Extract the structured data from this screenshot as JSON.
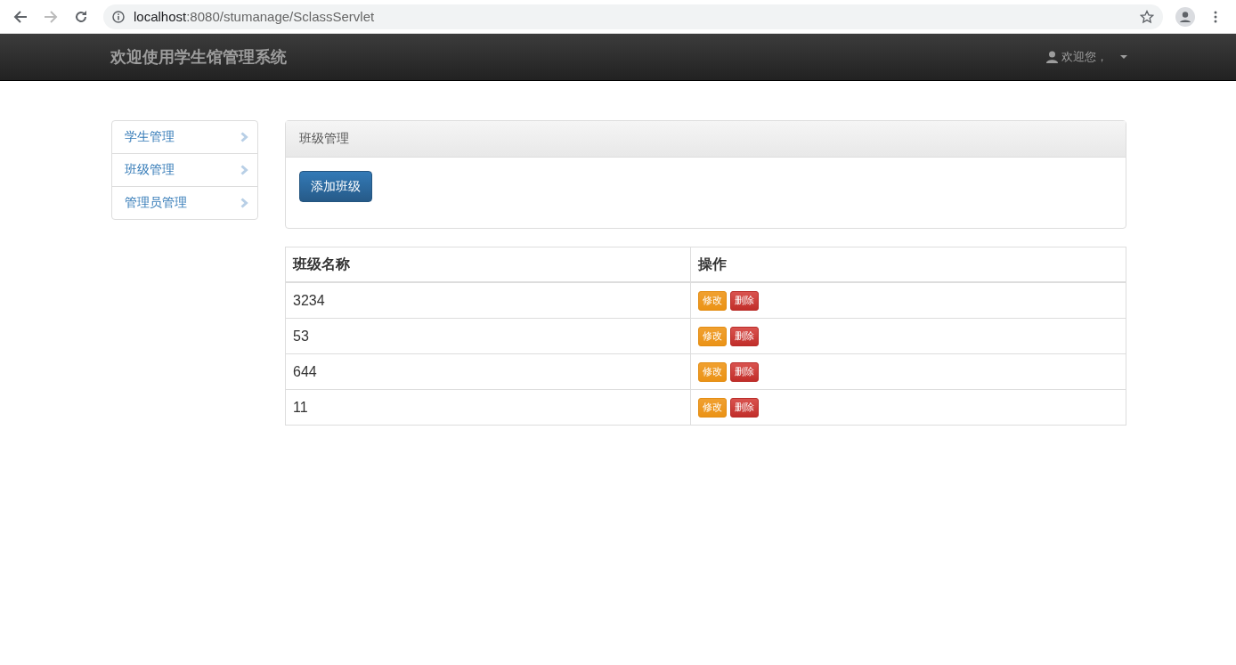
{
  "browser": {
    "address_host": "localhost",
    "address_rest": ":8080/stumanage/SclassServlet"
  },
  "navbar": {
    "brand": "欢迎使用学生馆管理系统",
    "user_menu": "欢迎您，"
  },
  "sidebar": {
    "items": [
      "学生管理",
      "班级管理",
      "管理员管理"
    ]
  },
  "panel": {
    "heading": "班级管理",
    "add_button": "添加班级"
  },
  "table": {
    "columns": [
      "班级名称",
      "操作"
    ],
    "rows": [
      {
        "name": "3234",
        "actions": [
          {
            "kind": "edit",
            "label": "修改"
          },
          {
            "kind": "delete",
            "label": "删除"
          }
        ]
      },
      {
        "name": "53",
        "actions": [
          {
            "kind": "edit",
            "label": "修改"
          },
          {
            "kind": "delete",
            "label": "删除"
          }
        ]
      },
      {
        "name": "644",
        "actions": [
          {
            "kind": "edit",
            "label": "修改"
          },
          {
            "kind": "delete",
            "label": "删除"
          }
        ]
      },
      {
        "name": "11",
        "actions": [
          {
            "kind": "edit",
            "label": "修改"
          },
          {
            "kind": "delete",
            "label": "删除"
          }
        ]
      }
    ]
  }
}
